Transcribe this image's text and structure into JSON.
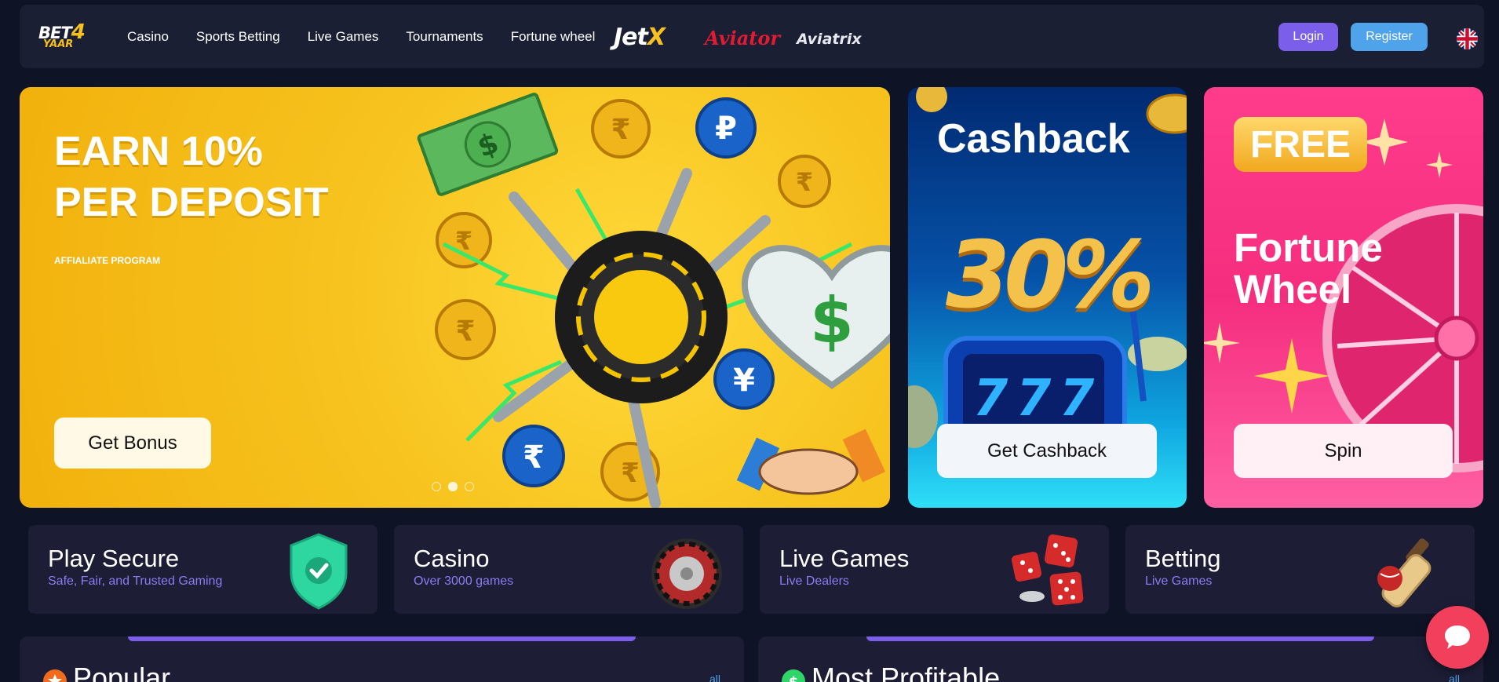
{
  "header": {
    "logo_top": "BET",
    "logo_four": "4",
    "logo_bottom": "YAAR",
    "nav": [
      "Casino",
      "Sports Betting",
      "Live Games",
      "Tournaments",
      "Fortune wheel"
    ],
    "brands": {
      "jetx_a": "Jet",
      "jetx_b": "X",
      "aviator": "Aviator",
      "aviatrix": "Aviatrix"
    },
    "login": "Login",
    "register": "Register",
    "language_icon": "uk-flag-icon"
  },
  "banners": {
    "affiliate": {
      "title": "EARN 10%\nPER DEPOSIT",
      "subtitle": "AFFIALIATE PROGRAM",
      "button": "Get Bonus",
      "slides_total": 3,
      "active_slide": 2
    },
    "cashback": {
      "title": "Cashback",
      "percent": "30%",
      "button": "Get Cashback"
    },
    "wheel": {
      "badge": "FREE",
      "title": "Fortune\nWheel",
      "button": "Spin"
    }
  },
  "features": [
    {
      "title": "Play Secure",
      "subtitle": "Safe, Fair, and Trusted Gaming",
      "icon": "shield-check-icon"
    },
    {
      "title": "Casino",
      "subtitle": "Over 3000 games",
      "icon": "roulette-icon"
    },
    {
      "title": "Live Games",
      "subtitle": "Live Dealers",
      "icon": "dice-icon"
    },
    {
      "title": "Betting",
      "subtitle": "Live Games",
      "icon": "cricket-bat-icon"
    }
  ],
  "sections": [
    {
      "title": "Popular",
      "all": "all",
      "icon": "star-icon"
    },
    {
      "title": "Most Profitable",
      "all": "all",
      "icon": "dollar-icon"
    }
  ],
  "colors": {
    "background": "#0f1326",
    "header": "#1a1f33",
    "card": "#1d1d36",
    "accent_purple": "#7b5fea",
    "accent_blue": "#4fa3ea",
    "chat": "#f23f5b"
  }
}
